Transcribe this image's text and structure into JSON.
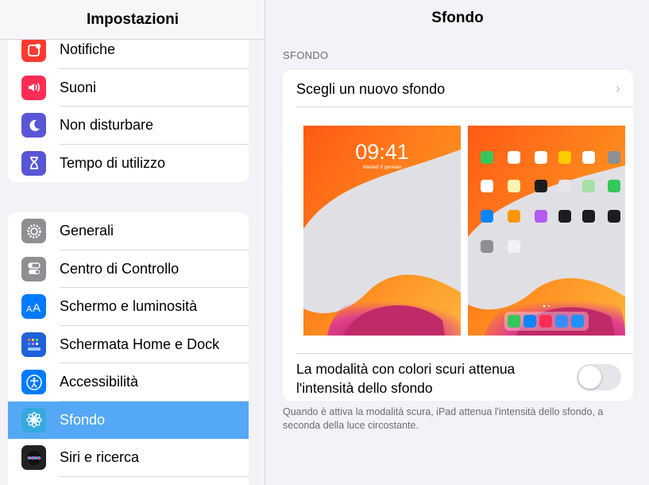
{
  "sidebar": {
    "title": "Impostazioni",
    "group1": [
      {
        "label": "Notifiche",
        "icon": "notifications-icon",
        "color": "#ff3b30"
      },
      {
        "label": "Suoni",
        "icon": "speaker-icon",
        "color": "#ff2d55"
      },
      {
        "label": "Non disturbare",
        "icon": "moon-icon",
        "color": "#5856d6"
      },
      {
        "label": "Tempo di utilizzo",
        "icon": "hourglass-icon",
        "color": "#5856d6"
      }
    ],
    "group2": [
      {
        "label": "Generali",
        "icon": "gear-icon",
        "color": "#8e8e93"
      },
      {
        "label": "Centro di Controllo",
        "icon": "toggles-icon",
        "color": "#8e8e93"
      },
      {
        "label": "Schermo e luminosità",
        "icon": "text-size-icon",
        "color": "#007aff"
      },
      {
        "label": "Schermata Home e Dock",
        "icon": "home-grid-icon",
        "color": "#2060d8"
      },
      {
        "label": "Accessibilità",
        "icon": "accessibility-icon",
        "color": "#007aff"
      },
      {
        "label": "Sfondo",
        "icon": "flower-icon",
        "color": "#35aadc",
        "selected": true
      },
      {
        "label": "Siri e ricerca",
        "icon": "siri-icon",
        "color": "#222222"
      }
    ]
  },
  "main": {
    "title": "Sfondo",
    "section_label": "SFONDO",
    "choose_label": "Scegli un nuovo sfondo",
    "lock_preview": {
      "time": "09:41",
      "date": "Martedì 9 gennaio"
    },
    "dark_mode_label": "La modalità con colori scuri attenua l'intensità dello sfondo",
    "dark_mode_enabled": false,
    "footnote": "Quando è attiva la modalità scura, iPad attenua l'intensità dello sfondo, a seconda della luce circostante."
  },
  "colors": {
    "selected_row": "#54a8f5",
    "background": "#f2f2f7",
    "wallpaper_orange": "#ff6a1a",
    "wallpaper_pink": "#e0408a"
  }
}
